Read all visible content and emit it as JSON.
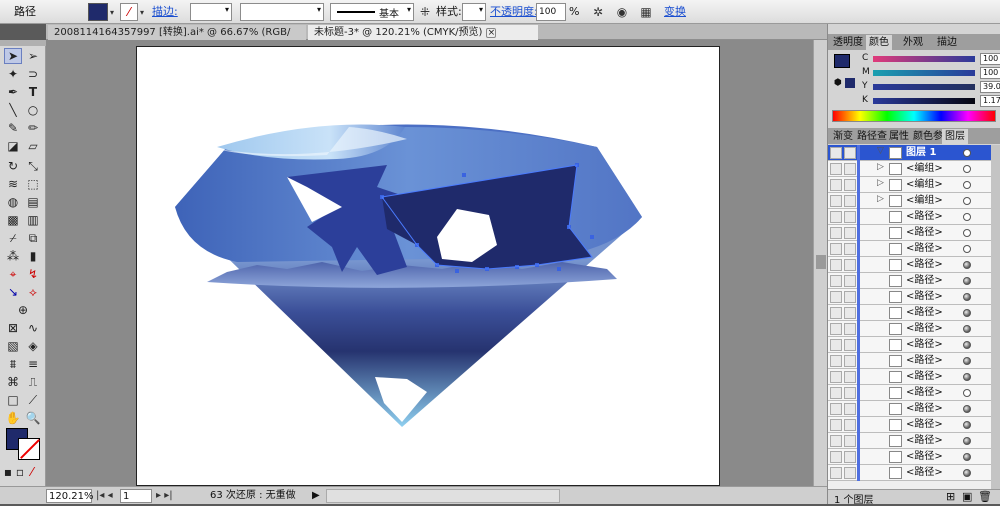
{
  "control_bar": {
    "object_type": "路径",
    "stroke_label": "描边:",
    "brush_label": "基本",
    "style_label": "样式:",
    "opacity_label": "不透明度:",
    "opacity_value": "100",
    "opacity_unit": "%",
    "transform_label": "变换",
    "fill_color": "#1f2a6b"
  },
  "document_tabs": [
    {
      "label": "20081141643579​97 [转换].ai* @ 66.67% (RGB/预览)",
      "active": false
    },
    {
      "label": "未标题-3* @ 120.21% (CMYK/预览)",
      "active": true
    }
  ],
  "status_bar": {
    "zoom": "120.21%",
    "page": "1",
    "history": "63 次还原 : 无重做"
  },
  "color_panel": {
    "tabs": [
      "透明度",
      "颜色",
      "外观",
      "描边"
    ],
    "active_tab": "颜色",
    "channels": [
      {
        "name": "C",
        "value": "100",
        "unit": "%"
      },
      {
        "name": "M",
        "value": "100",
        "unit": "%"
      },
      {
        "name": "Y",
        "value": "39.06",
        "unit": "%"
      },
      {
        "name": "K",
        "value": "1.17",
        "unit": "%"
      }
    ],
    "swatch": "#1f2a6b"
  },
  "layers_panel": {
    "tabs": [
      "渐变",
      "路径查",
      "属性",
      "颜色参",
      "图层"
    ],
    "active_tab": "图层",
    "rows": [
      {
        "name": "图层 1",
        "selected": true,
        "arrow": "▽",
        "target": "empty"
      },
      {
        "name": "<编组>",
        "selected": false,
        "arrow": "▷",
        "target": "empty"
      },
      {
        "name": "<编组>",
        "selected": false,
        "arrow": "▷",
        "target": "empty"
      },
      {
        "name": "<编组>",
        "selected": false,
        "arrow": "▷",
        "target": "empty"
      },
      {
        "name": "<路径>",
        "selected": false,
        "arrow": "",
        "target": "empty"
      },
      {
        "name": "<路径>",
        "selected": false,
        "arrow": "",
        "target": "empty"
      },
      {
        "name": "<路径>",
        "selected": false,
        "arrow": "",
        "target": "empty"
      },
      {
        "name": "<路径>",
        "selected": false,
        "arrow": "",
        "target": "filled"
      },
      {
        "name": "<路径>",
        "selected": false,
        "arrow": "",
        "target": "filled"
      },
      {
        "name": "<路径>",
        "selected": false,
        "arrow": "",
        "target": "filled"
      },
      {
        "name": "<路径>",
        "selected": false,
        "arrow": "",
        "target": "filled"
      },
      {
        "name": "<路径>",
        "selected": false,
        "arrow": "",
        "target": "filled"
      },
      {
        "name": "<路径>",
        "selected": false,
        "arrow": "",
        "target": "filled"
      },
      {
        "name": "<路径>",
        "selected": false,
        "arrow": "",
        "target": "filled"
      },
      {
        "name": "<路径>",
        "selected": false,
        "arrow": "",
        "target": "filled"
      },
      {
        "name": "<路径>",
        "selected": false,
        "arrow": "",
        "target": "empty"
      },
      {
        "name": "<路径>",
        "selected": false,
        "arrow": "",
        "target": "filled"
      },
      {
        "name": "<路径>",
        "selected": false,
        "arrow": "",
        "target": "filled"
      },
      {
        "name": "<路径>",
        "selected": false,
        "arrow": "",
        "target": "filled"
      },
      {
        "name": "<路径>",
        "selected": false,
        "arrow": "",
        "target": "filled"
      },
      {
        "name": "<路径>",
        "selected": false,
        "arrow": "",
        "target": "filled"
      }
    ],
    "footer": "1 个图层"
  }
}
